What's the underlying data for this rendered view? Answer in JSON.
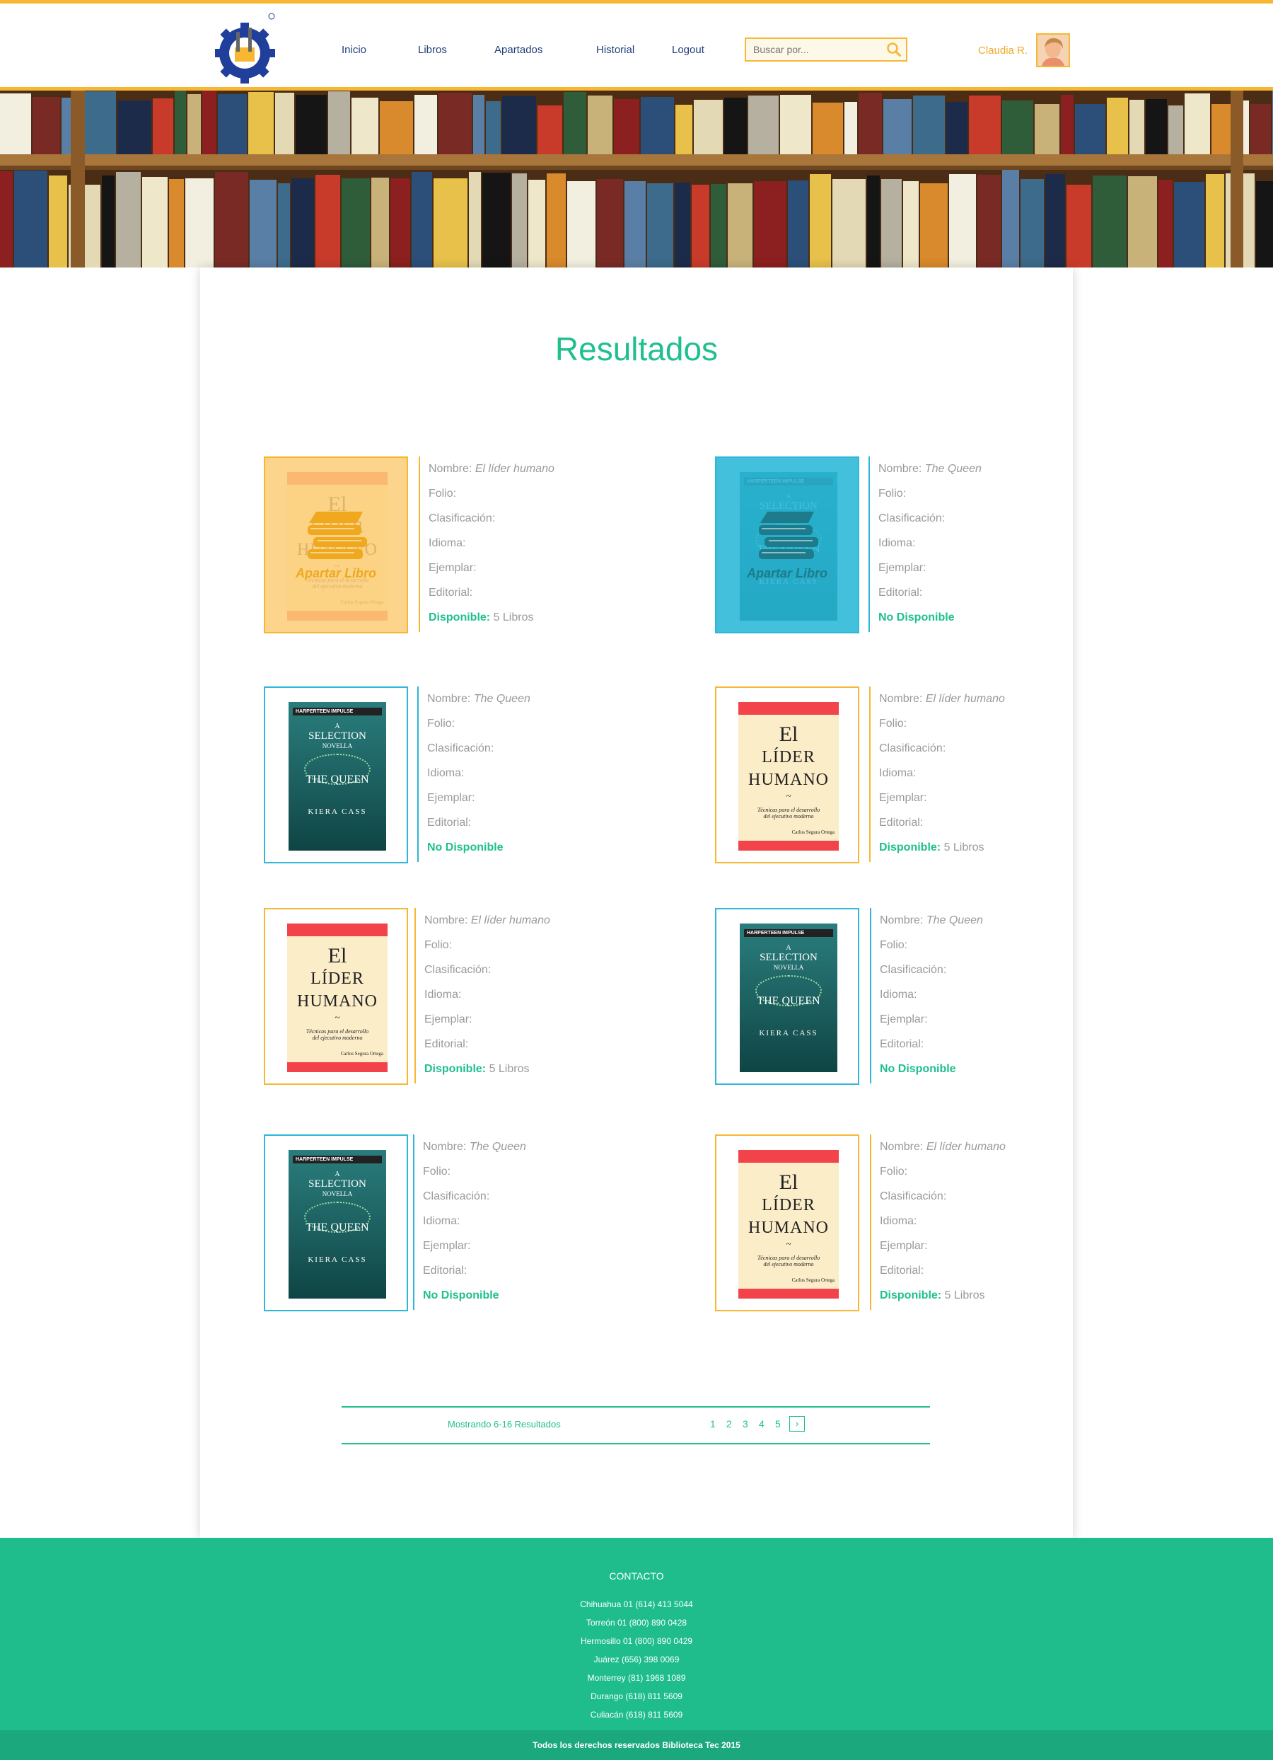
{
  "nav": {
    "items": [
      "Inicio",
      "Libros",
      "Apartados",
      "Historial",
      "Logout"
    ],
    "search_placeholder": "Buscar por...",
    "user_name": "Claudia R."
  },
  "main": {
    "title": "Resultados",
    "overlay_label": "Apartar Libro",
    "labels": {
      "name": "Nombre:",
      "folio": "Folio:",
      "classification": "Clasificación:",
      "language": "Idioma:",
      "copy": "Ejemplar:",
      "publisher": "Editorial:",
      "available": "Disponible:",
      "unavailable": "No Disponible"
    },
    "books": [
      {
        "name": "El líder humano",
        "available": true,
        "count": "5 Libros",
        "cover": "lider"
      },
      {
        "name": "The Queen",
        "available": false,
        "count": "",
        "cover": "queen"
      },
      {
        "name": "The Queen",
        "available": false,
        "count": "",
        "cover": "queen"
      },
      {
        "name": "El líder humano",
        "available": true,
        "count": "5 Libros",
        "cover": "lider"
      },
      {
        "name": "El líder humano",
        "available": true,
        "count": "5 Libros",
        "cover": "lider"
      },
      {
        "name": "The Queen",
        "available": false,
        "count": "",
        "cover": "queen"
      },
      {
        "name": "The Queen",
        "available": false,
        "count": "",
        "cover": "queen"
      },
      {
        "name": "El líder humano",
        "available": true,
        "count": "5 Libros",
        "cover": "lider"
      }
    ],
    "covers": {
      "lider": {
        "line1": "El",
        "line2": "LÍDER",
        "line3": "HUMANO",
        "sub1": "Técnicas para el desarrollo",
        "sub2": "del ejecutivo moderno",
        "author": "Carlos Segura Ortega"
      },
      "queen": {
        "brand": "HARPERTEEN IMPULSE",
        "line1": "A",
        "line2": "SELECTION",
        "line3": "NOVELLA",
        "line4": "THE QUEEN",
        "author": "KIERA CASS"
      }
    }
  },
  "pagination": {
    "summary": "Mostrando 6-16 Resultados",
    "pages": [
      "1",
      "2",
      "3",
      "4",
      "5"
    ],
    "next": "›"
  },
  "footer": {
    "heading": "CONTACTO",
    "contacts": [
      "Chihuahua 01 (614) 413 5044",
      "Torreón 01 (800) 890 0428",
      "Hermosillo 01 (800) 890 0429",
      "Juárez (656) 398 0069",
      "Monterrey (81) 1968 1089",
      "Durango (618) 811 5609",
      "Culiacán (618) 811 5609"
    ],
    "copyright": "Todos los derechos reservados Biblioteca Tec 2015"
  },
  "colors": {
    "accent": "#f7b733",
    "green": "#1fbf8f",
    "blue": "#2fb6d8",
    "nav_text": "#1f3f7a"
  }
}
